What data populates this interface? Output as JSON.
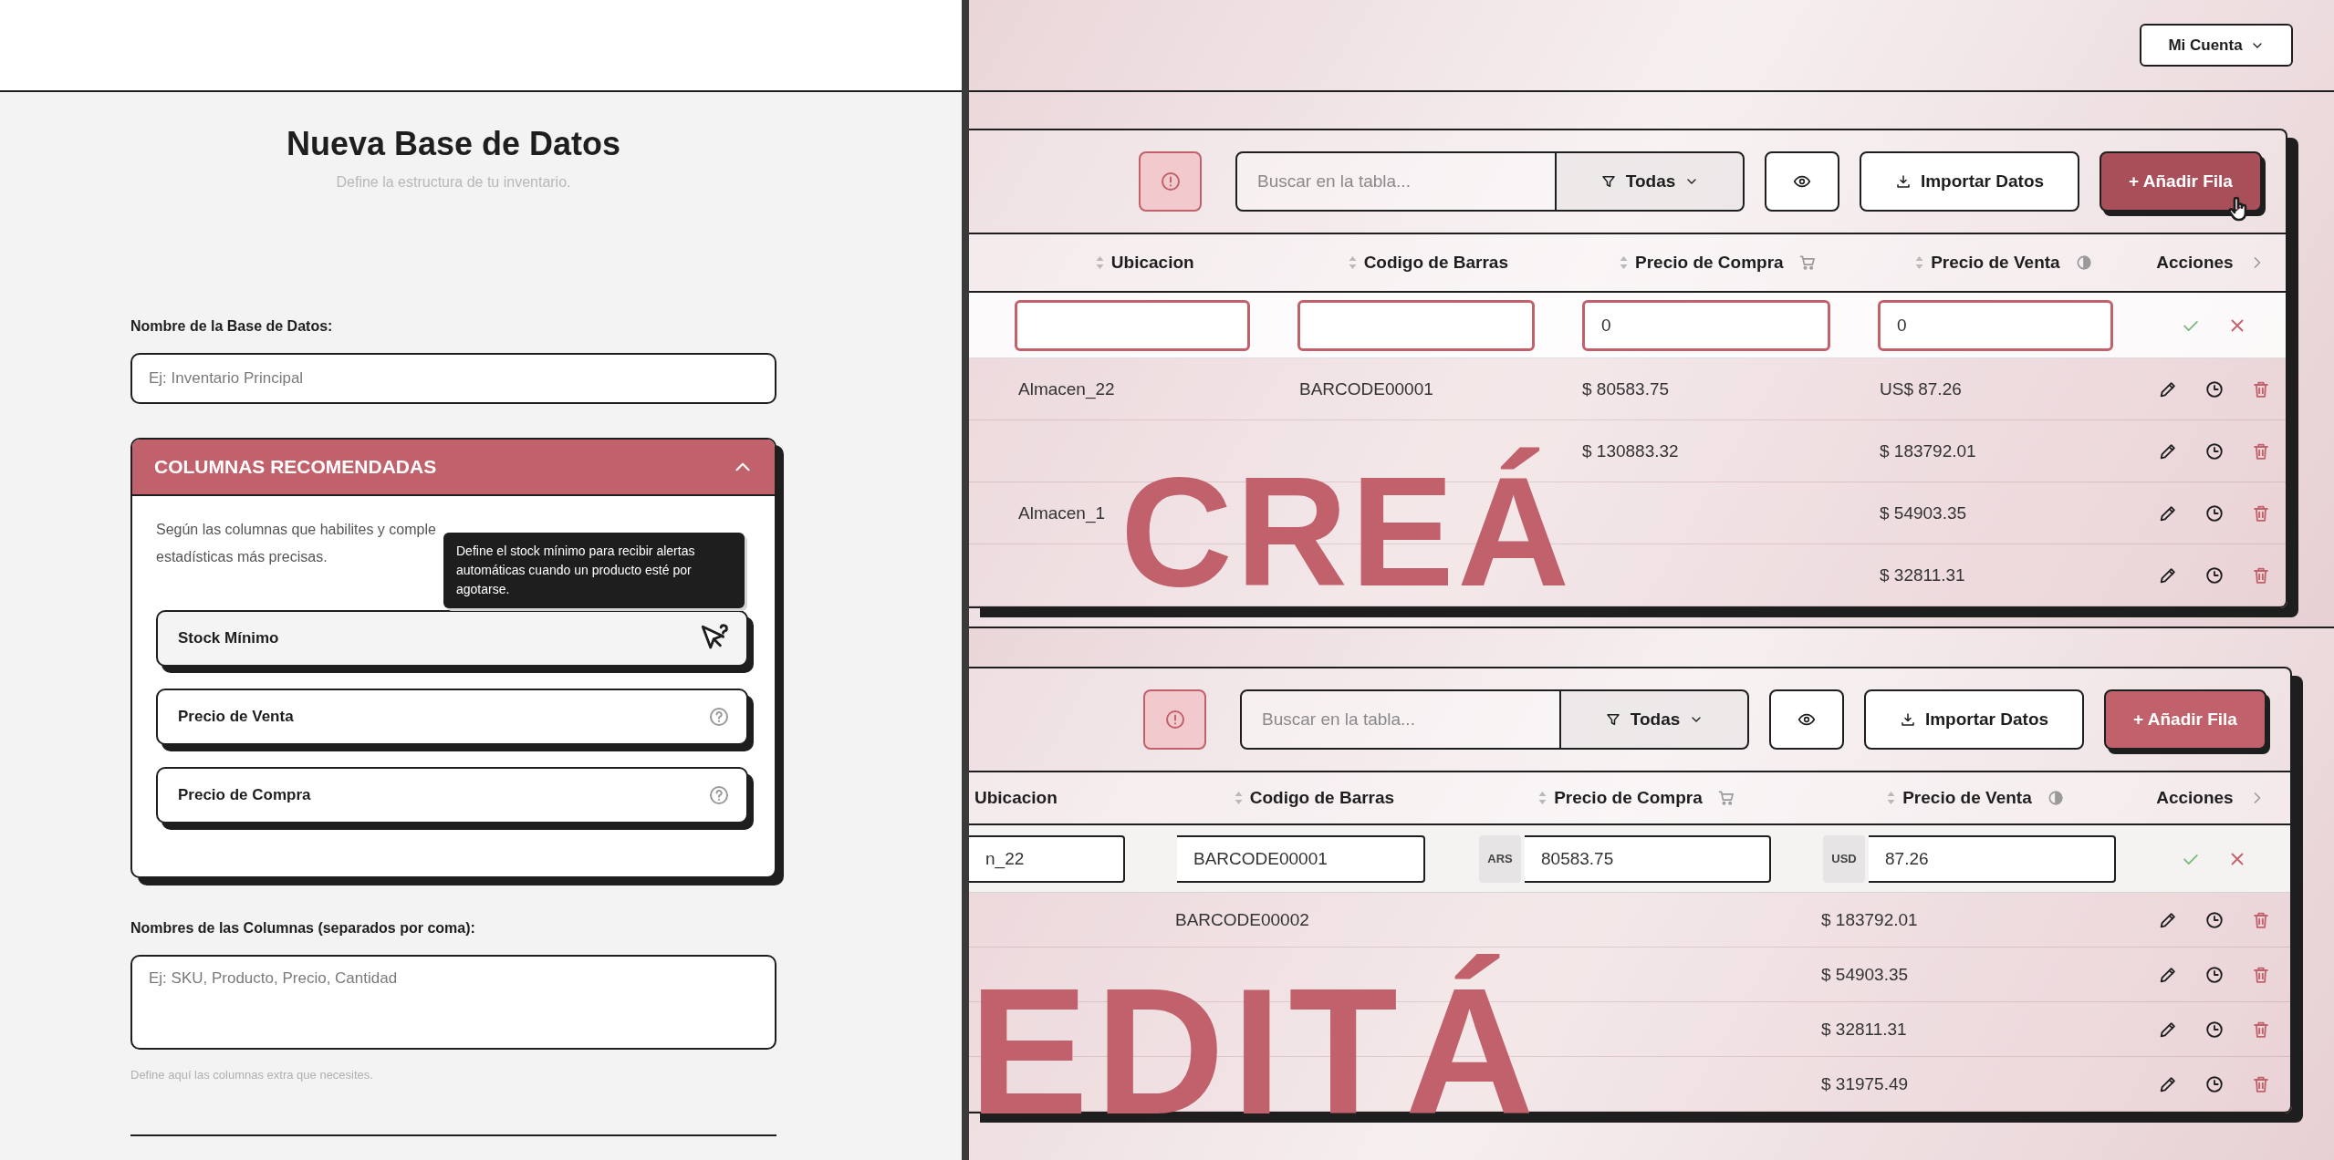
{
  "left": {
    "title": "Nueva Base de Datos",
    "subtitle": "Define la estructura de tu inventario.",
    "name_field": {
      "label": "Nombre de la Base de Datos:",
      "placeholder": "Ej: Inventario Principal"
    },
    "recommended": {
      "title": "COLUMNAS RECOMENDADAS",
      "expanded": true,
      "description_lines": [
        "Según las columnas que habilites y comple",
        "estadísticas más precisas."
      ],
      "tooltip": "Define el stock mínimo para recibir alertas automáticas cuando un producto esté por agotarse.",
      "items": [
        {
          "label": "Stock Mínimo",
          "hovered": true
        },
        {
          "label": "Precio de Venta",
          "hovered": false
        },
        {
          "label": "Precio de Compra",
          "hovered": false
        }
      ]
    },
    "columns_field": {
      "label": "Nombres de las Columnas (separados por coma):",
      "placeholder": "Ej: SKU, Producto, Precio, Cantidad",
      "hint": "Define aquí las columnas extra que necesites."
    }
  },
  "right": {
    "account_button": "Mi Cuenta",
    "panels": [
      {
        "overlay_word": "CREÁ",
        "search_placeholder": "Buscar en la tabla...",
        "filter": "Todas",
        "import_button": "Importar Datos",
        "add_button": {
          "label": "+ Añadir Fila",
          "hovered": true
        },
        "columns": [
          {
            "label": "Ubicacion"
          },
          {
            "label": "Codigo de Barras"
          },
          {
            "label": "Precio de Compra",
            "kind": "purchase"
          },
          {
            "label": "Precio de Venta",
            "kind": "sale"
          },
          {
            "label": "Acciones",
            "kind": "actions"
          }
        ],
        "input_row": {
          "kind": "new",
          "fields": [
            {
              "kind": "text"
            },
            {
              "kind": "text"
            },
            {
              "kind": "text",
              "value": "0"
            },
            {
              "kind": "text",
              "value": "0"
            }
          ]
        },
        "rows": [
          [
            "Almacen_22",
            "BARCODE00001",
            "$ 80583.75",
            "US$ 87.26"
          ],
          [
            null,
            null,
            "$ 130883.32",
            "$ 183792.01"
          ],
          [
            "Almacen_1",
            null,
            null,
            "$ 54903.35"
          ],
          [
            null,
            null,
            null,
            "$ 32811.31"
          ]
        ]
      },
      {
        "overlay_word": "EDITÁ",
        "search_placeholder": "Buscar en la tabla...",
        "filter": "Todas",
        "import_button": "Importar Datos",
        "add_button": {
          "label": "+ Añadir Fila",
          "hovered": false
        },
        "columns": [
          {
            "label": "Ubicacion"
          },
          {
            "label": "Codigo de Barras"
          },
          {
            "label": "Precio de Compra",
            "kind": "purchase"
          },
          {
            "label": "Precio de Venta",
            "kind": "sale"
          },
          {
            "label": "Acciones",
            "kind": "actions"
          }
        ],
        "input_row": {
          "kind": "edit",
          "fields": [
            {
              "kind": "text",
              "value": "n_22"
            },
            {
              "kind": "text",
              "value": "BARCODE00001"
            },
            {
              "kind": "currency",
              "currency": "ARS",
              "value": "80583.75"
            },
            {
              "kind": "currency",
              "currency": "USD",
              "value": "87.26"
            }
          ]
        },
        "rows": [
          [
            null,
            "BARCODE00002",
            null,
            "$ 183792.01"
          ],
          [
            null,
            null,
            null,
            "$ 54903.35"
          ],
          [
            null,
            null,
            null,
            "$ 32811.31"
          ],
          [
            null,
            null,
            null,
            "$ 31975.49"
          ]
        ]
      }
    ]
  }
}
